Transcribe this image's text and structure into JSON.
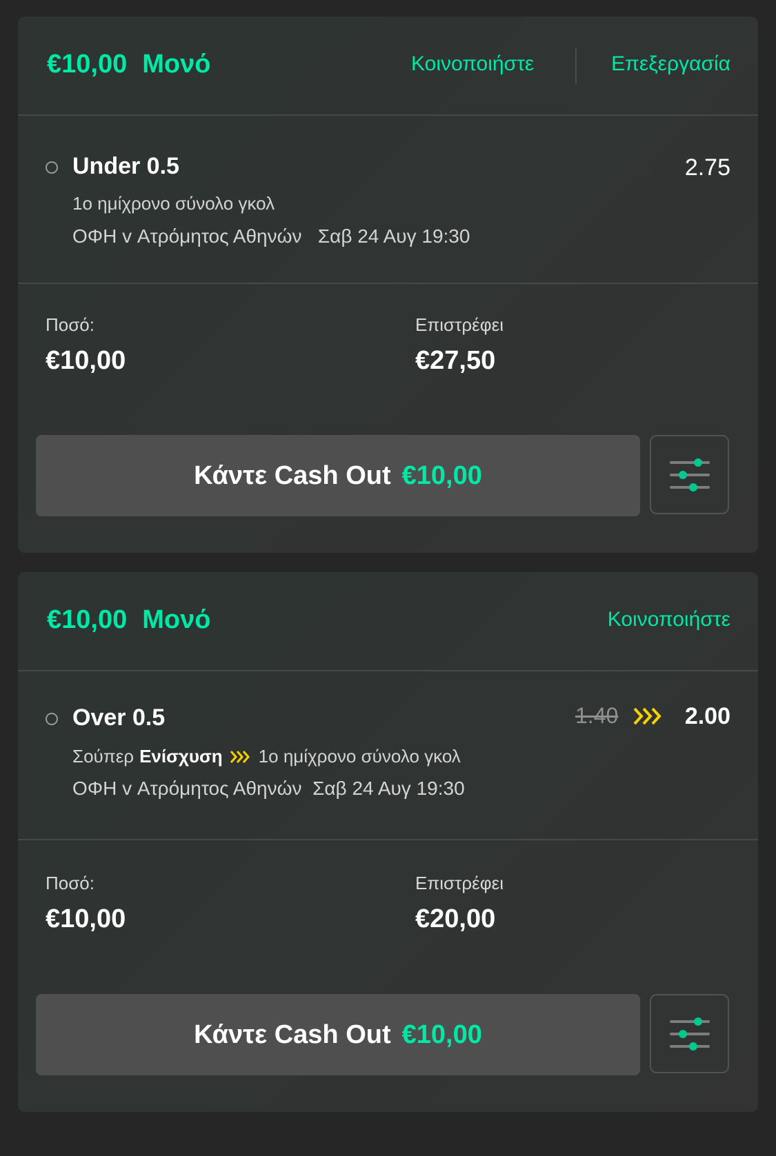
{
  "colors": {
    "accent": "#00e8a6",
    "boost": "#f5d300",
    "card_bg": "#2f3433",
    "button_bg": "#4f4f4f"
  },
  "bets": [
    {
      "stake_label": "€10,00",
      "bet_type": "Μονό",
      "share_label": "Κοινοποιήστε",
      "edit_label": "Επεξεργασία",
      "selection": "Under 0.5",
      "odds": "2.75",
      "market": "1ο ημίχρονο σύνολο γκολ",
      "event": "ΟΦΗ v Ατρόμητος Αθηνών",
      "datetime": "Σαβ 24 Αυγ 19:30",
      "amount_label": "Ποσό:",
      "amount_value": "€10,00",
      "returns_label": "Επιστρέφει",
      "returns_value": "€27,50",
      "cashout_label": "Κάντε Cash Out",
      "cashout_amount": "€10,00",
      "settings_icon": "sliders-icon"
    },
    {
      "stake_label": "€10,00",
      "bet_type": "Μονό",
      "share_label": "Κοινοποιήστε",
      "selection": "Over 0.5",
      "odds_old": "1.40",
      "odds": "2.00",
      "boost_prefix": "Σούπερ",
      "boost_name": "Ενίσχυση",
      "market": "1ο ημίχρονο σύνολο γκολ",
      "event": "ΟΦΗ v Ατρόμητος Αθηνών",
      "datetime": "Σαβ 24 Αυγ 19:30",
      "amount_label": "Ποσό:",
      "amount_value": "€10,00",
      "returns_label": "Επιστρέφει",
      "returns_value": "€20,00",
      "cashout_label": "Κάντε Cash Out",
      "cashout_amount": "€10,00",
      "settings_icon": "sliders-icon"
    }
  ]
}
